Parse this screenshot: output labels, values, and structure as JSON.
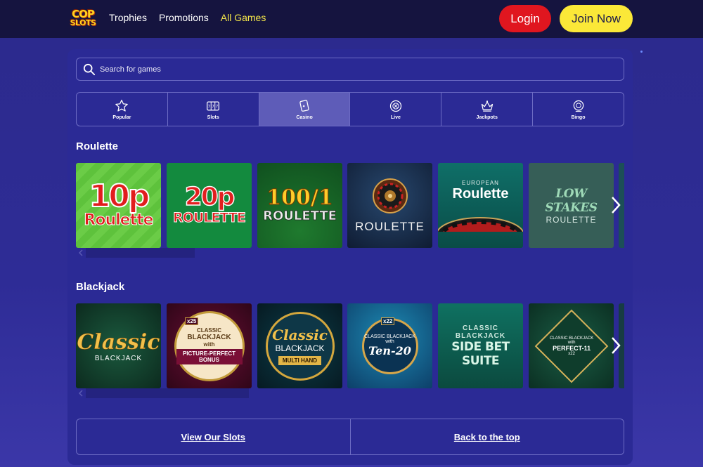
{
  "header": {
    "logo_line1": "COP",
    "logo_line2": "SLOTS",
    "nav": [
      {
        "label": "Trophies"
      },
      {
        "label": "Promotions"
      },
      {
        "label": "All Games"
      }
    ],
    "login_label": "Login",
    "join_label": "Join Now"
  },
  "search": {
    "placeholder": "Search for games"
  },
  "categories": [
    {
      "label": "Popular",
      "icon": "star-icon"
    },
    {
      "label": "Slots",
      "icon": "slot-reels-icon"
    },
    {
      "label": "Casino",
      "icon": "cards-icon",
      "active": true
    },
    {
      "label": "Live",
      "icon": "roulette-wheel-icon"
    },
    {
      "label": "Jackpots",
      "icon": "crown-icon"
    },
    {
      "label": "Bingo",
      "icon": "bingo-ball-icon"
    }
  ],
  "sections": {
    "roulette": {
      "title": "Roulette",
      "games": [
        {
          "big": "10p",
          "sub": "Roulette"
        },
        {
          "big": "20p",
          "sub": "ROULETTE"
        },
        {
          "big": "100/1",
          "sub": "ROULETTE"
        },
        {
          "sub": "ROULETTE"
        },
        {
          "small": "EUROPEAN",
          "sub": "Roulette"
        },
        {
          "big": "LOW STAKES",
          "sub": "ROULETTE"
        }
      ]
    },
    "blackjack": {
      "title": "Blackjack",
      "games": [
        {
          "big": "Classic",
          "sub": "BLACKJACK"
        },
        {
          "small": "CLASSIC",
          "mid": "BLACKJACK",
          "tiny": "with",
          "banner": "PICTURE-PERFECT BONUS",
          "badge": "x25"
        },
        {
          "big": "Classic",
          "sub": "BLACKJACK",
          "banner": "MULTI HAND"
        },
        {
          "small": "CLASSIC BLACKJACK",
          "tiny": "with",
          "big": "Ten-20",
          "badge": "x22"
        },
        {
          "small": "CLASSIC BLACKJACK",
          "sub": "SIDE BET SUITE"
        },
        {
          "small": "CLASSIC BLACKJACK",
          "tiny": "with",
          "mid": "PERFECT-11",
          "badge": "x22"
        }
      ]
    }
  },
  "footer": {
    "view_slots": "View Our Slots",
    "back_to_top": "Back to the top"
  },
  "colors": {
    "background": "#2b2a95",
    "header": "#15143f",
    "login": "#e0161f",
    "join": "#fbe838",
    "active_nav": "#f4e64a",
    "active_category": "#5e5cb8"
  }
}
